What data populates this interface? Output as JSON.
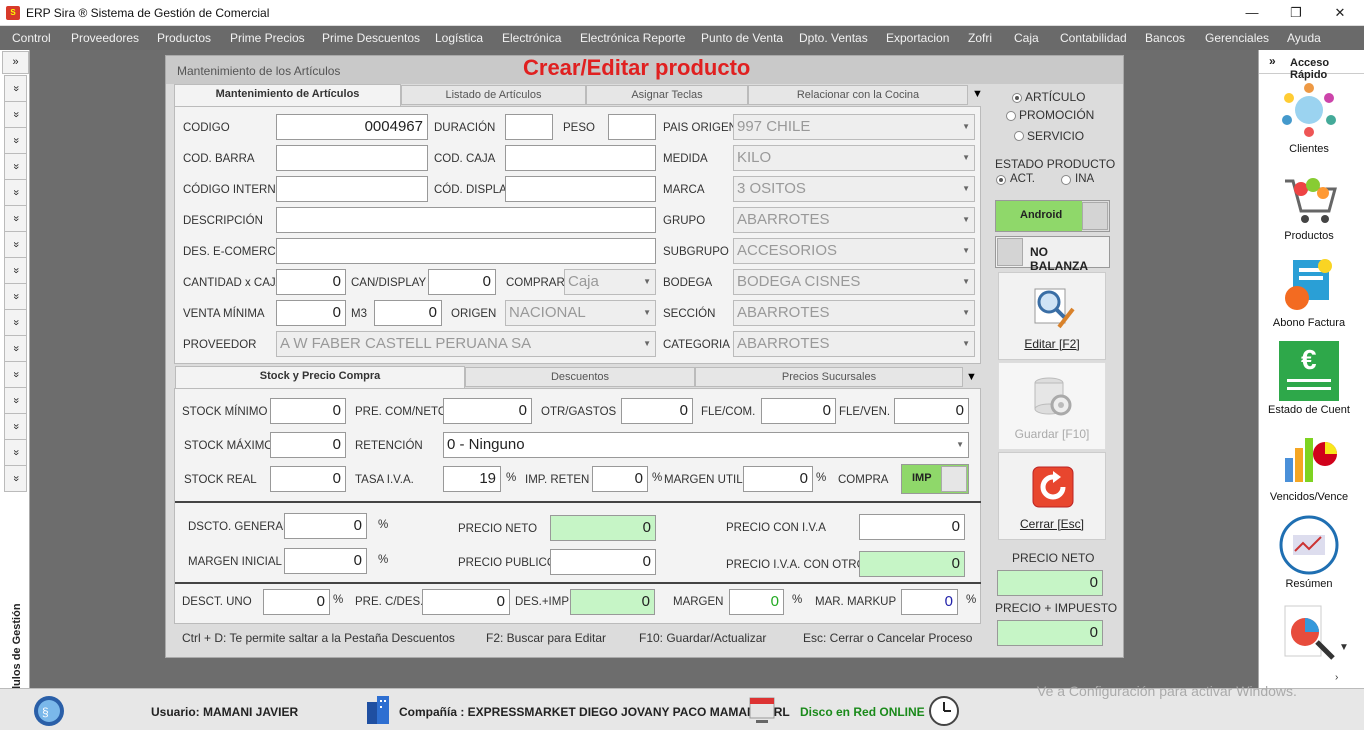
{
  "window": {
    "title": "ERP Sira ® Sistema de Gestión de Comercial",
    "minimize": "—",
    "restore": "❐",
    "close": "✕"
  },
  "menu": [
    "Control",
    "Proveedores",
    "Productos",
    "Prime Precios",
    "Prime Descuentos",
    "Logística",
    "Electrónica",
    "Electrónica Reporte",
    "Punto de Venta",
    "Dpto. Ventas",
    "Exportacion",
    "Zofri",
    "Caja",
    "Contabilidad",
    "Bancos",
    "Gerenciales",
    "Ayuda"
  ],
  "rail": {
    "top": "»",
    "item": "»",
    "label": "Módulos de Gestión"
  },
  "panel": {
    "subtitle": "Mantenimiento de los Artículos",
    "title": "Crear/Editar producto"
  },
  "tabs": [
    "Mantenimiento de Artículos",
    "Listado de Artículos",
    "Asignar Teclas",
    "Relacionar con la Cocina"
  ],
  "form": {
    "codigo_l": "CODIGO",
    "codigo": "0004967",
    "duracion_l": "DURACIÓN",
    "duracion": "",
    "peso_l": "PESO",
    "peso": "",
    "pais_l": "PAIS ORIGEN",
    "pais": "997 CHILE",
    "barra_l": "COD. BARRA",
    "barra": "",
    "caja_l": "COD. CAJA",
    "caja": "",
    "medida_l": "MEDIDA",
    "medida": "KILO",
    "interno_l": "CÓDIGO INTERNO",
    "interno": "",
    "display_l": "CÓD. DISPLAY",
    "display": "",
    "marca_l": "MARCA",
    "marca": "3 OSITOS",
    "descripcion_l": "DESCRIPCIÓN",
    "descripcion": "",
    "grupo_l": "GRUPO",
    "grupo": "ABARROTES",
    "ecomerce_l": "DES. E-COMERCE",
    "ecomerce": "",
    "subgrupo_l": "SUBGRUPO",
    "subgrupo": "ACCESORIOS",
    "cantcaja_l": "CANTIDAD x CAJA",
    "cantcaja": "0",
    "candisplay_l": "CAN/DISPLAY",
    "candisplay": "0",
    "comprar_l": "COMPRAR",
    "comprar": "Caja",
    "bodega_l": "BODEGA",
    "bodega": "BODEGA CISNES",
    "ventamin_l": "VENTA MÍNIMA",
    "ventamin": "0",
    "m3_l": "M3",
    "m3": "0",
    "origen_l": "ORIGEN",
    "origen": "NACIONAL",
    "seccion_l": "SECCIÓN",
    "seccion": "ABARROTES",
    "proveedor_l": "PROVEEDOR",
    "proveedor": "A W FABER CASTELL PERUANA SA",
    "categoria_l": "CATEGORIA",
    "categoria": "ABARROTES"
  },
  "tabs2": [
    "Stock y Precio Compra",
    "Descuentos",
    "Precios Sucursales"
  ],
  "stock": {
    "smin_l": "STOCK MÍNIMO",
    "smin": "0",
    "precom_l": "PRE. COM/NETO",
    "precom": "0",
    "otr_l": "OTR/GASTOS",
    "otr": "0",
    "flecom_l": "FLE/COM.",
    "flecom": "0",
    "fleven_l": "FLE/VEN.",
    "fleven": "0",
    "smax_l": "STOCK MÁXIMO",
    "smax": "0",
    "ret_l": "RETENCIÓN",
    "ret": "0 - Ninguno",
    "sreal_l": "STOCK REAL",
    "sreal": "0",
    "iva_l": "TASA I.V.A.",
    "iva": "19",
    "impret_l": "IMP. RETEN",
    "impret": "0",
    "margen_l": "MARGEN UTIL.",
    "margen": "0",
    "compra_l": "COMPRA",
    "compra": "IMP",
    "pct": "%"
  },
  "precios": {
    "dscto_l": "DSCTO. GENERAL",
    "dscto": "0",
    "neto_l": "PRECIO NETO",
    "neto": "0",
    "coniva_l": "PRECIO CON I.V.A",
    "coniva": "0",
    "minicial_l": "MARGEN INICIAL",
    "minicial": "0",
    "publico_l": "PRECIO PUBLICO",
    "publico": "0",
    "ivaotro_l": "PRECIO I.V.A. CON OTRO",
    "ivaotro": "0",
    "descuno_l": "DESCT. UNO",
    "descuno": "0",
    "precdes_l": "PRE. C/DES.",
    "precdes": "0",
    "desimp_l": "DES.+IMP",
    "desimp": "0",
    "margen_l": "MARGEN",
    "margen": "0",
    "markup_l": "MAR. MARKUP",
    "markup": "0"
  },
  "status": [
    "Ctrl + D: Te permite saltar a la Pestaña Descuentos",
    "F2: Buscar para Editar",
    "F10: Guardar/Actualizar",
    "Esc: Cerrar o Cancelar Proceso"
  ],
  "side": {
    "articulo": "ARTÍCULO",
    "promocion": "PROMOCIÓN",
    "servicio": "SERVICIO",
    "estado_l": "ESTADO PRODUCTO",
    "act": "ACT.",
    "ina": "INA",
    "android": "Android",
    "balanza": "NO BALANZA",
    "editar": "Editar [F2]",
    "guardar": "Guardar [F10]",
    "cerrar": "Cerrar [Esc]",
    "neto_l": "PRECIO NETO",
    "neto": "0",
    "imp_l": "PRECIO + IMPUESTO",
    "imp": "0"
  },
  "quick": {
    "title": "Acceso Rápido",
    "arrow": "»",
    "items": [
      "Clientes",
      "Productos",
      "Abono Factura",
      "Estado de Cuent",
      "Vencidos/Vence",
      "Resúmen"
    ]
  },
  "bottom": {
    "usuario": "Usuario: MAMANI JAVIER",
    "compania": "Compañía : EXPRESSMARKET DIEGO JOVANY PACO MAMANI EIRL",
    "disco": "Disco en Red ONLINE",
    "watermark": "Ve a Configuración para activar Windows."
  },
  "colors": {
    "menubar": "#6a6a6a",
    "accent_red": "#e02020",
    "green_field": "#c6f5c6",
    "android_green": "#8fd86a"
  }
}
